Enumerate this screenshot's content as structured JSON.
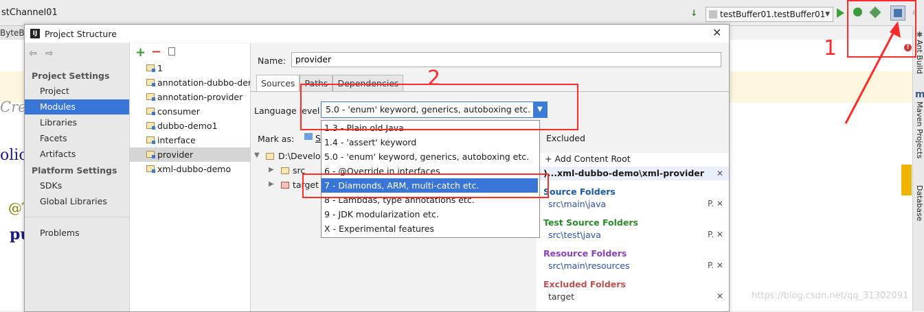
{
  "ide": {
    "breadcrumb": "stChannel01",
    "tab_fragment": "ByteBu",
    "run_config": "testBuffer01.testBuffer01",
    "code_fragments": [
      "Cre",
      "olic",
      "@T",
      "pu"
    ],
    "right_tools": [
      "Ant Build",
      "Maven Projects",
      "Database"
    ],
    "run_icon": "run-icon",
    "debug_icon": "debug-icon",
    "coverage_icon": "coverage-icon",
    "project_structure_icon": "project-structure-icon"
  },
  "annotations": {
    "one": "1",
    "two": "2",
    "color": "#ff2a2a"
  },
  "dialog": {
    "title": "Project Structure",
    "close_label": "✕",
    "nav": {
      "project_settings_header": "Project Settings",
      "project": "Project",
      "modules": "Modules",
      "libraries": "Libraries",
      "facets": "Facets",
      "artifacts": "Artifacts",
      "platform_settings_header": "Platform Settings",
      "sdks": "SDKs",
      "global_libraries": "Global Libraries",
      "problems": "Problems"
    },
    "modules": [
      "1",
      "annotation-dubbo-dem",
      "annotation-provider",
      "consumer",
      "dubbo-demo1",
      "interface",
      "provider",
      "xml-dubbo-demo"
    ],
    "selected_module": "provider",
    "name_label": "Name:",
    "name_value": "provider",
    "tabs": [
      "Sources",
      "Paths",
      "Dependencies"
    ],
    "language_level_label": "Language level:",
    "language_level_value": "5.0 - 'enum' keyword, generics, autoboxing etc.",
    "language_options": [
      "1.3 - Plain old Java",
      "1.4 - 'assert' keyword",
      "5.0 - 'enum' keyword, generics, autoboxing etc.",
      "6 - @Override in interfaces",
      "7 - Diamonds, ARM, multi-catch etc.",
      "8 - Lambdas, type annotations etc.",
      "9 - JDK modularization etc.",
      "X - Experimental features"
    ],
    "highlighted_option": "7 - Diamonds, ARM, multi-catch etc.",
    "mark_as_label": "Mark as:",
    "mark_as_s": "S",
    "excluded_label": "Excluded",
    "tree": {
      "root": "D:\\Develop",
      "src": "src",
      "target": "target"
    },
    "add_content_root": "Add Content Root",
    "content_root": ")...xml-dubbo-demo\\xml-provider",
    "source_folders_title": "Source Folders",
    "source_folders_path": "src\\main\\java",
    "test_source_folders_title": "Test Source Folders",
    "test_source_folders_path": "src\\test\\java",
    "resource_folders_title": "Resource Folders",
    "resource_folders_path": "src\\main\\resources",
    "excluded_folders_title": "Excluded Folders",
    "excluded_folders_path": "target",
    "folder_colors": {
      "source": "#1b59a8",
      "test": "#2a8a2a",
      "resource": "#8a3ec0",
      "excluded": "#c0504d"
    }
  },
  "watermark": "https://blog.csdn.net/qq_31302091"
}
